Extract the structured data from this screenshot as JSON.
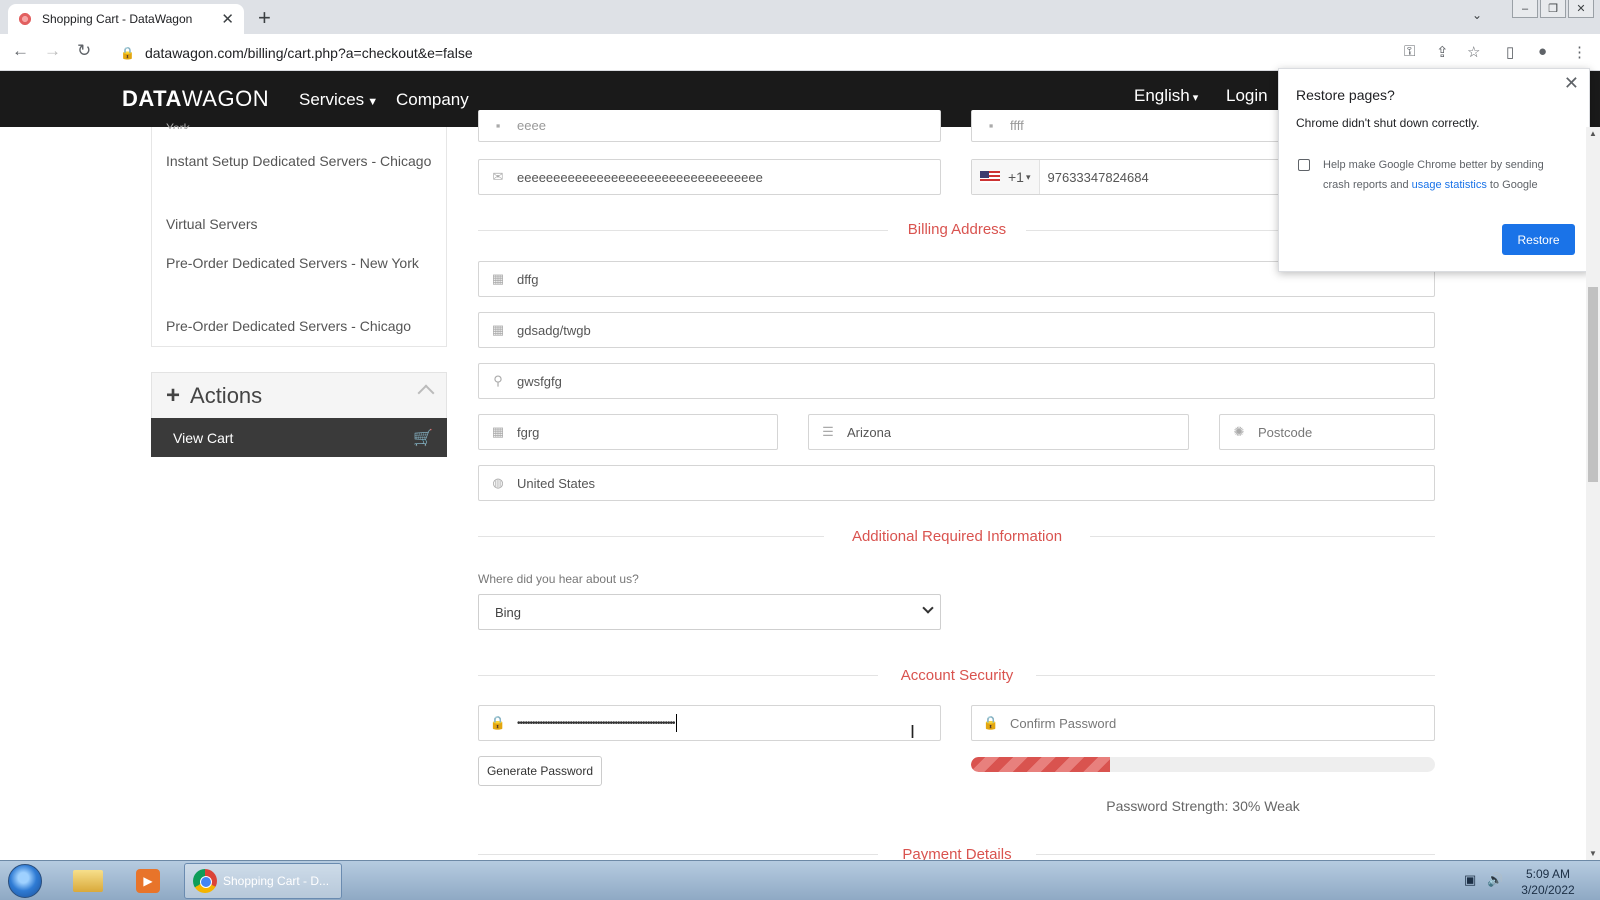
{
  "browser": {
    "tab_title": "Shopping Cart - DataWagon",
    "url": "datawagon.com/billing/cart.php?a=checkout&e=false"
  },
  "sitenav": {
    "logo_bold": "DATA",
    "logo_light": "WAGON",
    "services": "Services",
    "company": "Company",
    "language": "English",
    "login": "Login"
  },
  "sidebar": {
    "partial": "York",
    "items": [
      "Instant Setup Dedicated Servers - Chicago",
      "Virtual Servers",
      "Pre-Order Dedicated Servers - New York",
      "Pre-Order Dedicated Servers - Chicago"
    ],
    "actions_title": "Actions",
    "view_cart": "View Cart"
  },
  "form": {
    "top_left_partial": "eeee",
    "top_right_partial": "ffff",
    "email": "eeeeeeeeeeeeeeeeeeeeeeeeeeeeeeeeee",
    "phone_code": "+1",
    "phone": "97633347824684",
    "billing_title": "Billing Address",
    "company_name": "dffg",
    "address1": "gdsadg/twgb",
    "address2": "gwsfgfg",
    "city": "fgrg",
    "state": "Arizona",
    "postcode_placeholder": "Postcode",
    "country": "United States",
    "additional_title": "Additional Required Information",
    "hear_label": "Where did you hear about us?",
    "hear_value": "Bing",
    "security_title": "Account Security",
    "password_mask": "•••••••••••••••••••••••••••••••••••••••••••••••••••••••••••••••",
    "confirm_placeholder": "Confirm Password",
    "generate_password": "Generate Password",
    "password_strength_pct": 30,
    "password_strength_text": "Password Strength: 30% Weak",
    "payment_title": "Payment Details"
  },
  "popup": {
    "title": "Restore pages?",
    "message": "Chrome didn't shut down correctly.",
    "check_text_1": "Help make Google Chrome better by sending crash reports and ",
    "check_link": "usage statistics",
    "check_text_2": " to Google",
    "restore": "Restore"
  },
  "taskbar": {
    "chrome_label": "Shopping Cart - D...",
    "time": "5:09 AM",
    "date": "3/20/2022"
  },
  "colors": {
    "accent_red": "#d9534f",
    "nav_bg": "#1a1a1a",
    "restore_blue": "#1a73e8"
  }
}
